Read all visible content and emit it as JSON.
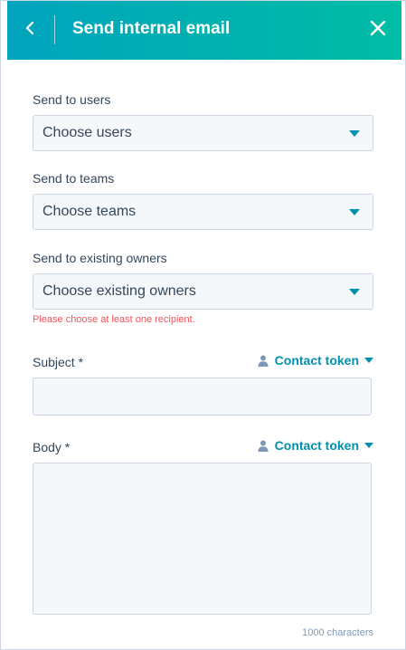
{
  "header": {
    "title": "Send internal email",
    "back_icon": "chevron-left-icon",
    "close_icon": "close-icon"
  },
  "form": {
    "users": {
      "label": "Send to users",
      "value": "Choose users"
    },
    "teams": {
      "label": "Send to teams",
      "value": "Choose teams"
    },
    "owners": {
      "label": "Send to existing owners",
      "value": "Choose existing owners"
    },
    "error": "Please choose at least one recipient.",
    "subject": {
      "label": "Subject *",
      "token_label": "Contact token",
      "value": ""
    },
    "body": {
      "label": "Body *",
      "token_label": "Contact token",
      "value": "",
      "counter": "1000 characters"
    }
  },
  "colors": {
    "header_gradient_start": "#00a4bd",
    "header_gradient_end": "#00bda5",
    "accent": "#0091ae",
    "error": "#f2545b",
    "field_bg": "#f5f8fa",
    "field_border": "#cbd6e2"
  }
}
